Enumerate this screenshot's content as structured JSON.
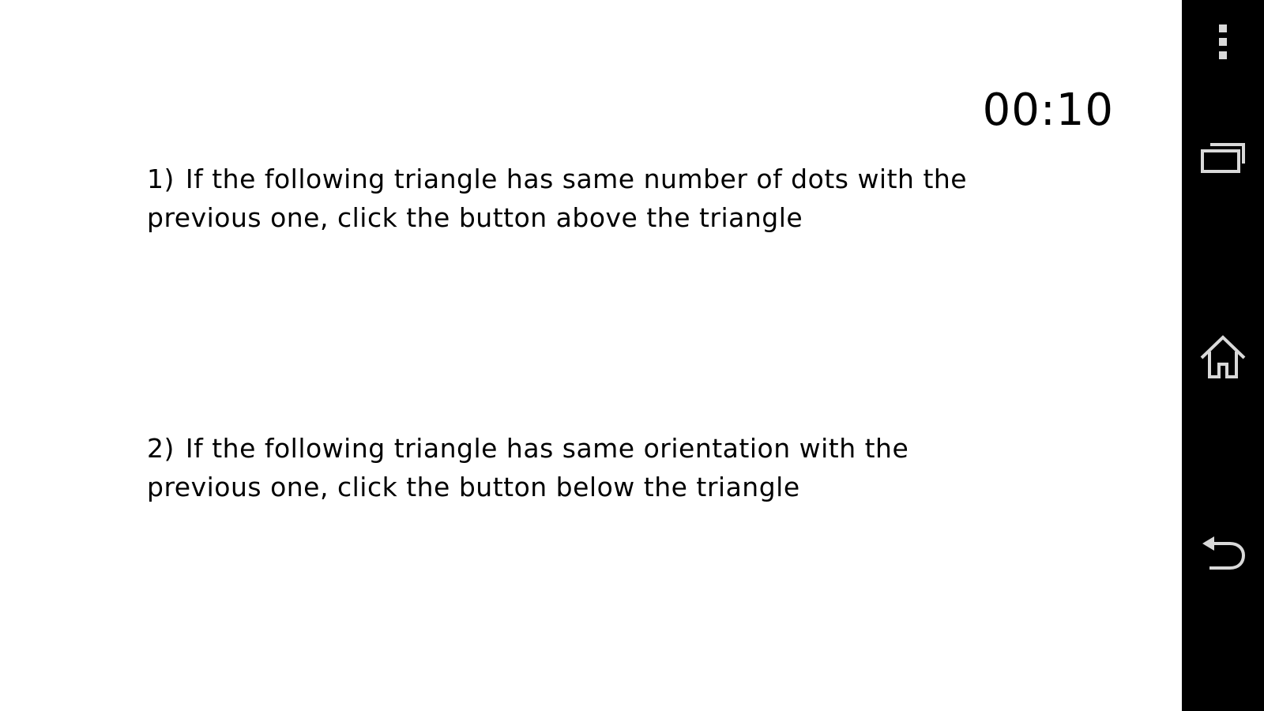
{
  "timer": {
    "value": "00:10"
  },
  "instructions": [
    {
      "number": "1)",
      "line1": "If the following triangle has same number of dots with the",
      "line2": "previous one, click the button above the triangle"
    },
    {
      "number": "2)",
      "line1": "If the following triangle has same orientation with the",
      "line2": "previous one, click the button below the triangle"
    }
  ],
  "navbar": {
    "icons": [
      "overflow-menu-icon",
      "recent-apps-icon",
      "home-icon",
      "back-icon"
    ],
    "icon_color": "#d9d9d9",
    "background": "#000000"
  }
}
